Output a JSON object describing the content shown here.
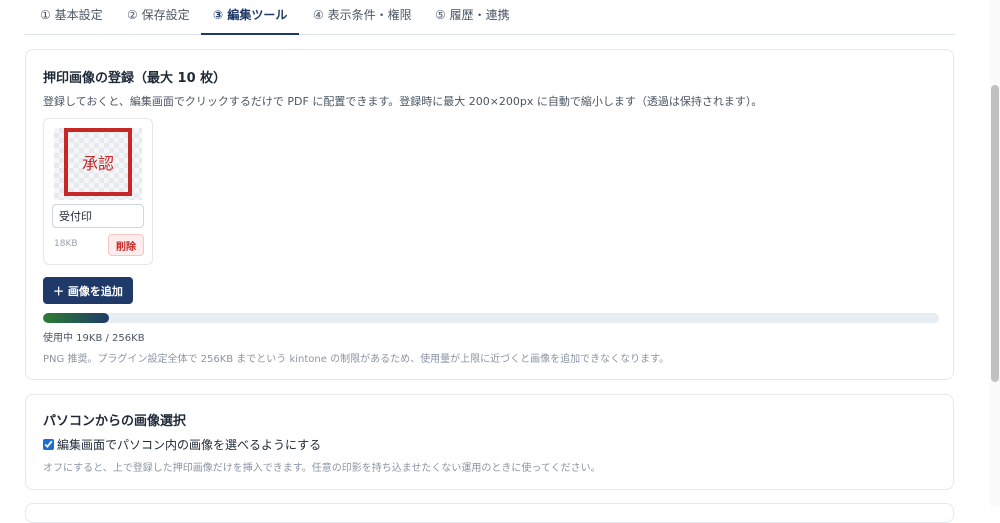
{
  "tabs": [
    {
      "label": "① 基本設定"
    },
    {
      "label": "② 保存設定"
    },
    {
      "label": "③ 編集ツール"
    },
    {
      "label": "④ 表示条件・権限"
    },
    {
      "label": "⑤ 履歴・連携"
    }
  ],
  "active_tab": "③ 編集ツール",
  "stamp_section": {
    "title": "押印画像の登録（最大 10 枚）",
    "description": "登録しておくと、編集画面でクリックするだけで PDF に配置できます。登録時に最大 200×200px に自動で縮小します（透過は保持されます）。",
    "stamps": [
      {
        "preview_text": "承認",
        "name_value": "受付印",
        "size": "18KB",
        "delete_label": "削除"
      }
    ],
    "add_button_label": "＋ 画像を追加",
    "usage": {
      "used_kb": 19,
      "limit_kb": 256,
      "fraction": 0.0742,
      "text": "使用中 19KB / 256KB"
    },
    "note": "PNG 推奨。プラグイン設定全体で 256KB までという kintone の制限があるため、使用量が上限に近づくと画像を追加できなくなります。"
  },
  "pc_section": {
    "title": "パソコンからの画像選択",
    "checkbox_label": "編集画面でパソコン内の画像を選べるようにする",
    "checkbox_checked": true,
    "note": "オフにすると、上で登録した押印画像だけを挿入できます。任意の印影を持ち込ませたくない運用のときに使ってください。"
  },
  "colors": {
    "primary": "#1f3a68",
    "stamp_red": "#c62828",
    "danger_bg": "#fdecec",
    "progress_start": "#2e7d32"
  }
}
